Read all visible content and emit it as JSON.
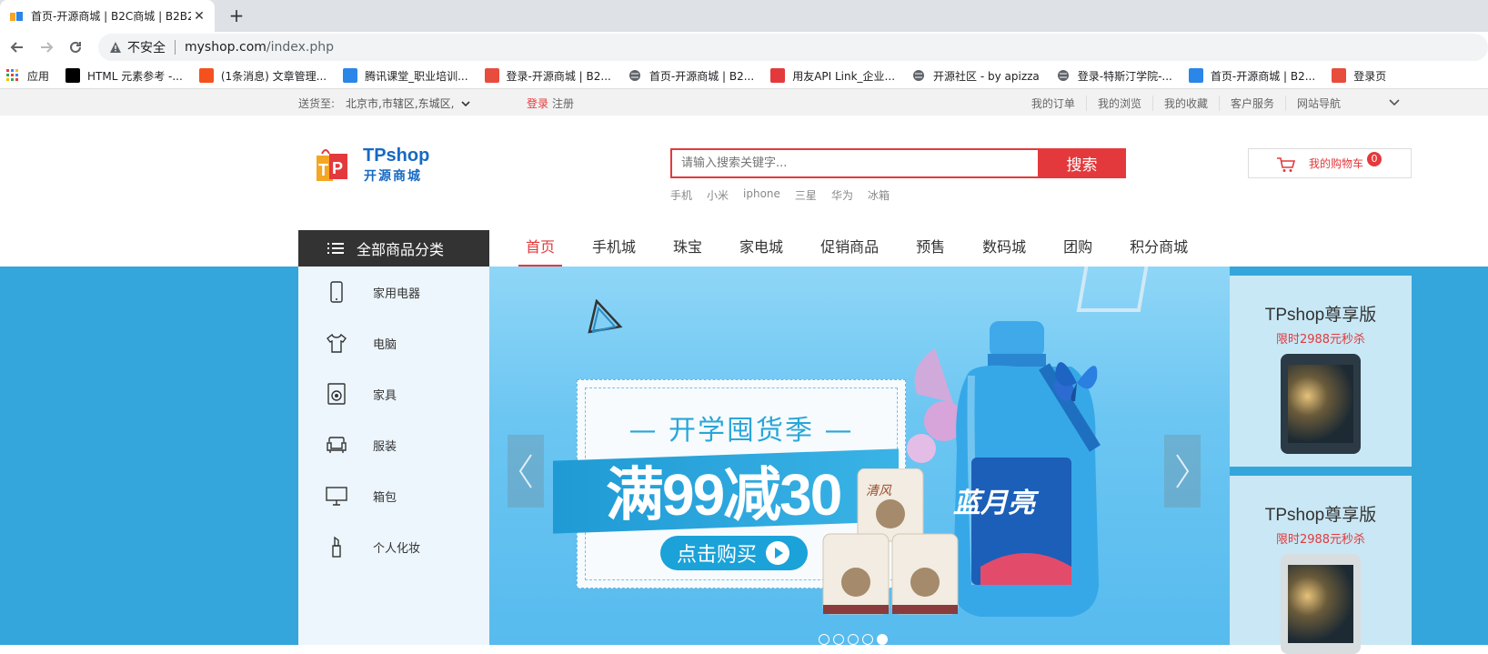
{
  "browser": {
    "tab_title": "首页-开源商城 | B2C商城 | B2B2",
    "new_tab": "+",
    "security": "不安全",
    "url_host": "myshop.com",
    "url_path": "/index.php"
  },
  "bookmarks": [
    {
      "label": "应用",
      "icon": "apps-grid-icon",
      "color": "#e94235"
    },
    {
      "label": "HTML 元素参考 -...",
      "icon": "mdn-icon",
      "color": "#000000"
    },
    {
      "label": "(1条消息) 文章管理...",
      "icon": "csdn-icon",
      "color": "#f4511e"
    },
    {
      "label": "腾讯课堂_职业培训...",
      "icon": "tencent-class-icon",
      "color": "#2a86e8"
    },
    {
      "label": "登录-开源商城 | B2...",
      "icon": "shop-bag-icon",
      "color": "#e84c3d"
    },
    {
      "label": "首页-开源商城 | B2...",
      "icon": "globe-icon",
      "color": "#5f6368"
    },
    {
      "label": "用友API Link_企业...",
      "icon": "yonyou-icon",
      "color": "#e4393c"
    },
    {
      "label": "开源社区 - by apizza",
      "icon": "globe-icon",
      "color": "#5f6368"
    },
    {
      "label": "登录-特斯汀学院-...",
      "icon": "globe-icon",
      "color": "#5f6368"
    },
    {
      "label": "首页-开源商城 | B2...",
      "icon": "tpshop-icon",
      "color": "#2a86e8"
    },
    {
      "label": "登录页",
      "icon": "shop-bag-icon",
      "color": "#e84c3d"
    }
  ],
  "topbar": {
    "deliver_label": "送货至:",
    "deliver_value": "北京市,市辖区,东城区,",
    "login": "登录",
    "register": "注册",
    "links": [
      "我的订单",
      "我的浏览",
      "我的收藏",
      "客户服务",
      "网站导航"
    ]
  },
  "header": {
    "logo_text": "TPshop",
    "logo_sub": "开源商城",
    "search_placeholder": "请输入搜索关键字...",
    "search_button": "搜索",
    "hotwords": [
      "手机",
      "小米",
      "iphone",
      "三星",
      "华为",
      "冰箱"
    ],
    "cart_label": "我的购物车",
    "cart_count": "0"
  },
  "nav": {
    "all_categories": "全部商品分类",
    "items": [
      "首页",
      "手机城",
      "珠宝",
      "家电城",
      "促销商品",
      "预售",
      "数码城",
      "团购",
      "积分商城"
    ],
    "active": "首页"
  },
  "sidebar": [
    {
      "label": "家用电器",
      "icon": "phone-icon"
    },
    {
      "label": "电脑",
      "icon": "tshirt-icon"
    },
    {
      "label": "家具",
      "icon": "washer-icon"
    },
    {
      "label": "服装",
      "icon": "sofa-icon"
    },
    {
      "label": "箱包",
      "icon": "monitor-icon"
    },
    {
      "label": "个人化妆",
      "icon": "lipstick-icon"
    }
  ],
  "banner": {
    "title": "— 开学囤货季 —",
    "headline": "满99减30",
    "cta": "点击购买",
    "product_brand": "蓝月亮",
    "tissue_brand": "清风"
  },
  "right_ads": [
    {
      "title": "TPshop尊享版",
      "subtitle": "限时2988元秒杀"
    },
    {
      "title": "TPshop尊享版",
      "subtitle": "限时2988元秒杀"
    }
  ],
  "colors": {
    "accent": "#e4393c",
    "banner_bg": "#34a6db",
    "nav_dark": "#333333"
  }
}
